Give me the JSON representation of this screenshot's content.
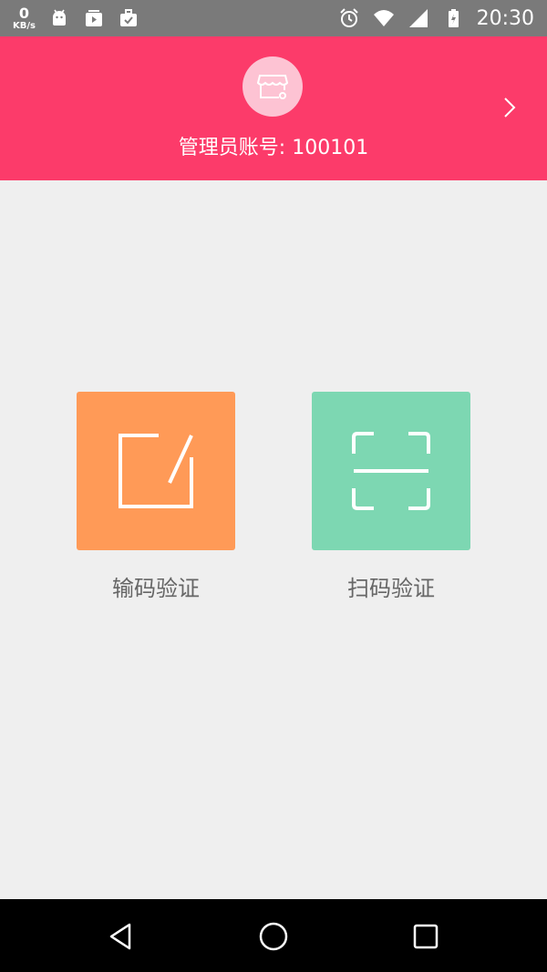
{
  "status_bar": {
    "speed_value": "0",
    "speed_unit": "KB/s",
    "time": "20:30",
    "icons_left": [
      "android-icon",
      "play-icon",
      "briefcase-check-icon"
    ],
    "icons_right": [
      "alarm-icon",
      "wifi-icon",
      "signal-icon",
      "battery-icon"
    ]
  },
  "header": {
    "background": "#fc3b6a",
    "avatar_icon": "store-settings-icon",
    "account_text": "管理员账号: 100101",
    "chevron_icon": "chevron-right-icon"
  },
  "actions": [
    {
      "label": "输码验证",
      "icon": "edit-icon",
      "color": "#ff9a57"
    },
    {
      "label": "扫码验证",
      "icon": "scan-icon",
      "color": "#7dd7b2"
    }
  ],
  "nav": {
    "back_icon": "back-icon",
    "home_icon": "home-icon",
    "recents_icon": "recents-icon"
  }
}
